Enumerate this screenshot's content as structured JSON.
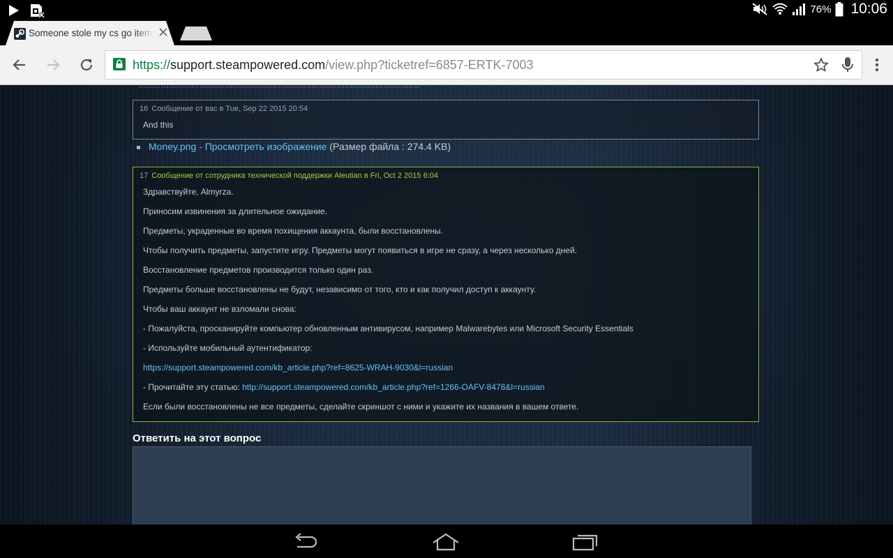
{
  "status_bar": {
    "battery_percent": "76%",
    "time": "10:06",
    "icons": [
      "play-icon",
      "sim-icon",
      "mute-icon",
      "wifi-icon",
      "signal-icon",
      "battery-icon"
    ]
  },
  "browser": {
    "tab": {
      "title": "Someone stole my cs go items"
    },
    "url": {
      "scheme": "https://",
      "host": "support.steampowered.com",
      "path": "/view.php?ticketref=6857-ERTK-7003"
    }
  },
  "ticket": {
    "user_message": {
      "number": "16",
      "header": "Сообщение от вас в Tue, Sep 22 2015 20:54",
      "body": "And this"
    },
    "attachment": {
      "file": "Money.png",
      "separator": " - ",
      "view_link": "Просмотреть изображение",
      "size": " (Размер файла : 274.4 KB)"
    },
    "support_message": {
      "number": "17",
      "header": "Сообщение от сотрудника технической поддержки Aleutian в Fri, Oct 2 2015 6:04",
      "lines": {
        "l1": "Здравствуйте, Almyrza.",
        "l2": "Приносим извинения за длительное ожидание.",
        "l3": "Предметы, украденные во время похищения аккаунта, были восстановлены.",
        "l4": "Чтобы получить предметы, запустите игру. Предметы могут появиться в игре не сразу, а через несколько дней.",
        "l5": "Восстановление предметов производится только один раз.",
        "l6": "Предметы больше восстановлены не будут, независимо от того, кто и как получил доступ к аккаунту.",
        "l7": "Чтобы ваш аккаунт не взломали снова:",
        "l8": "- Пожалуйста, просканируйте компьютер обновленным антивирусом, например Malwarebytes или Microsoft Security Essentials",
        "l9": "- Используйте мобильный аутентификатор:",
        "l10_link": "https://support.steampowered.com/kb_article.php?ref=8625-WRAH-9030&l=russian",
        "l11_prefix": "- Прочитайте эту статью: ",
        "l11_link": "http://support.steampowered.com/kb_article.php?ref=1266-OAFV-8478&l=russian",
        "l12": "Если были восстановлены не все предметы, сделайте скриншот с ними и укажите их названия в вашем ответе."
      }
    },
    "reply": {
      "title": "Ответить на этот вопрос"
    }
  }
}
